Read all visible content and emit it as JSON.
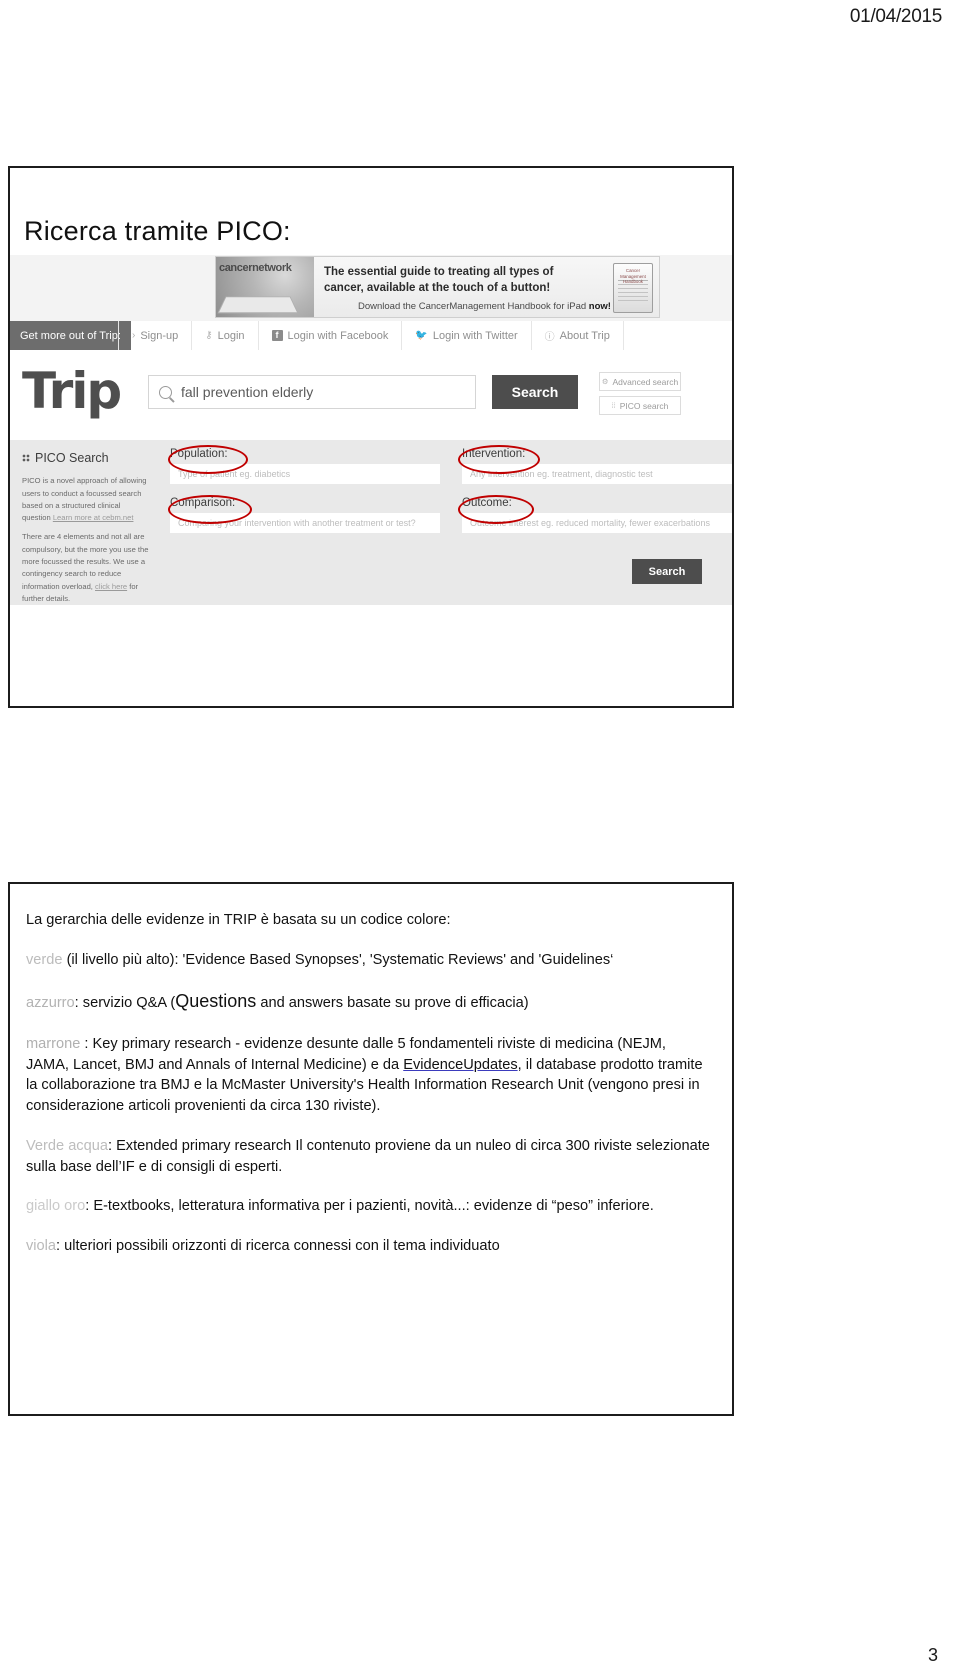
{
  "page": {
    "date": "01/04/2015",
    "number": "3"
  },
  "slide1": {
    "title": "Ricerca tramite PICO:",
    "banner": {
      "logo": "cancernetwork",
      "headline": "The essential guide to treating all types of cancer, available at the touch of a button!",
      "subline_prefix": "Download the ",
      "subline_brand": "CancerManagement",
      "subline_mid": " Handbook for iPad ",
      "subline_bold": "now!",
      "book_title": "Cancer Management Handbook"
    },
    "topbar": {
      "lead": "Get more out of Trip:",
      "items": [
        {
          "label": "Sign-up",
          "icon": "chevron-right-icon"
        },
        {
          "label": "Login",
          "icon": "key-icon"
        },
        {
          "label": "Login with Facebook",
          "icon": "facebook-icon"
        },
        {
          "label": "Login with Twitter",
          "icon": "twitter-bird-icon"
        },
        {
          "label": "About Trip",
          "icon": "info-circle-icon"
        }
      ]
    },
    "search": {
      "logo": "Trip",
      "query_value": "fall prevention elderly",
      "search_button": "Search",
      "advanced_search": "Advanced search",
      "pico_search": "PICO search"
    },
    "pico": {
      "heading": "PICO Search",
      "intro_1": "PICO is a novel approach of allowing users to conduct a focussed search based on a structured clinical question ",
      "intro_1_link": "Learn more at cebm.net",
      "intro_2_a": "There are 4 elements and not all are compulsory, but the more you use the more focussed the results. We use a contingency search to reduce information overload, ",
      "intro_2_link": "click here",
      "intro_2_b": " for further details.",
      "fields": [
        {
          "label": "Population:",
          "placeholder": "Type of patient eg. diabetics"
        },
        {
          "label": "Comparison:",
          "placeholder": "Comparing your intervention with another treatment or test?"
        },
        {
          "label": "Intervention:",
          "placeholder": "Any intervention eg. treatment, diagnostic test"
        },
        {
          "label": "Outcome:",
          "placeholder": "Outcome interest eg. reduced mortality, fewer exacerbations"
        }
      ],
      "search_button": "Search"
    },
    "annotations": {
      "color": "#c00000",
      "circled": [
        "Population:",
        "Intervention:",
        "Comparison:",
        "Outcome:"
      ]
    }
  },
  "slide2": {
    "intro": "La gerarchia delle evidenze in TRIP è basata su un codice colore:",
    "items": [
      {
        "keyword": "verde",
        "text": " (il livello più alto): 'Evidence Based Synopses', 'Systematic Reviews' and 'Guidelines‘"
      },
      {
        "keyword": "azzurro",
        "text_a": ": servizio Q&A (",
        "text_big": "Questions",
        "text_b": " and answers basate su prove di efficacia)"
      },
      {
        "keyword": "marrone",
        "text_a": " : Key primary research - evidenze desunte dalle  5 fondamenteli riviste di medicina (NEJM, JAMA, Lancet, BMJ and Annals of Internal Medicine) e da ",
        "link": "EvidenceUpdates",
        "text_b": ", il database prodotto tramite la collaborazione tra BMJ e la McMaster University's Health Information Research Unit (vengono presi in considerazione articoli provenienti da circa 130 riviste)."
      },
      {
        "keyword": "Verde acqua",
        "text": ": Extended primary research  Il contenuto proviene da un nuleo di circa 300 riviste selezionate sulla base dell’IF e di consigli di esperti."
      },
      {
        "keyword": "giallo oro",
        "text": ": E-textbooks, letteratura informativa per i pazienti, novità...: evidenze di “peso” inferiore."
      },
      {
        "keyword": "viola",
        "text": ": ulteriori possibili orizzonti di ricerca connessi con il tema individuato"
      }
    ]
  }
}
